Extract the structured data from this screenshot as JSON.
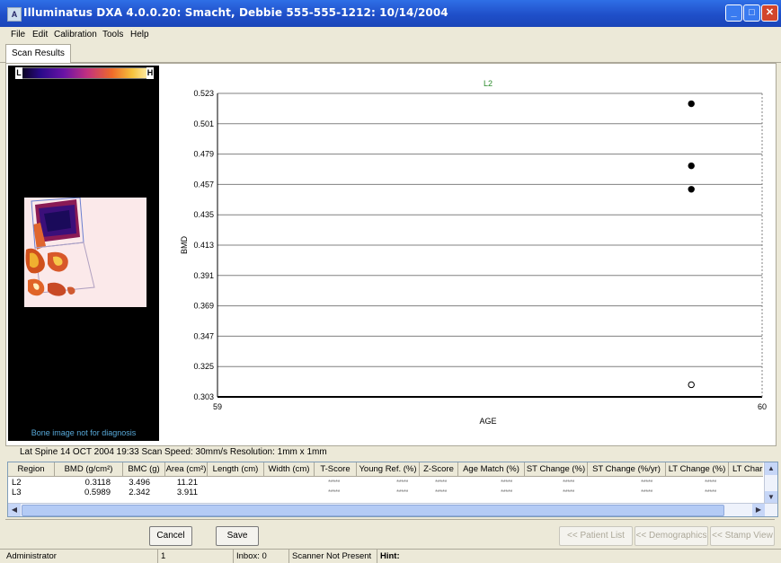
{
  "window": {
    "title": "Illuminatus DXA 4.0.0.20: Smacht, Debbie 555-555-1212: 10/14/2004"
  },
  "menu": [
    "File",
    "Edit",
    "Calibration",
    "Tools",
    "Help"
  ],
  "tabs": [
    "Scan Results"
  ],
  "bone_panel": {
    "scale_low": "L",
    "scale_high": "H",
    "note": "Bone image not for diagnosis"
  },
  "chart_data": {
    "type": "scatter",
    "title": "L2",
    "xlabel": "AGE",
    "ylabel": "BMD",
    "xlim": [
      59,
      60
    ],
    "ylim": [
      0.303,
      0.523
    ],
    "x_ticks": [
      "59",
      "60"
    ],
    "y_ticks": [
      "0.523",
      "0.501",
      "0.479",
      "0.457",
      "0.435",
      "0.413",
      "0.391",
      "0.369",
      "0.347",
      "0.325",
      "0.303"
    ],
    "grid": true,
    "points": [
      {
        "x": 59.87,
        "y": 0.5155,
        "filled": true
      },
      {
        "x": 59.87,
        "y": 0.4705,
        "filled": true
      },
      {
        "x": 59.87,
        "y": 0.4535,
        "filled": true
      },
      {
        "x": 59.87,
        "y": 0.3118,
        "filled": false
      }
    ]
  },
  "scan_info": "Lat Spine   14 OCT 2004   19:33   Scan Speed: 30mm/s   Resolution: 1mm x 1mm",
  "table": {
    "headers": [
      "Region",
      "BMD (g/cm²)",
      "BMC (g)",
      "Area (cm²)",
      "Length (cm)",
      "Width (cm)",
      "T-Score",
      "Young Ref. (%)",
      "Z-Score",
      "Age Match (%)",
      "ST Change (%)",
      "ST Change (%/yr)",
      "LT Change (%)",
      "LT Char"
    ],
    "rows": [
      [
        "L2",
        "0.3118",
        "3.496",
        "11.21",
        "",
        "",
        "*****",
        "*****",
        "*****",
        "*****",
        "*****",
        "*****",
        "*****",
        ""
      ],
      [
        "L3",
        "0.5989",
        "2.342",
        "3.911",
        "",
        "",
        "*****",
        "*****",
        "*****",
        "*****",
        "*****",
        "*****",
        "*****",
        ""
      ]
    ]
  },
  "buttons": {
    "cancel": "Cancel",
    "save": "Save",
    "patient_list": "<< Patient List",
    "demographics": "<< Demographics",
    "stamp_view": "<< Stamp View"
  },
  "status": {
    "user": "Administrator",
    "count": "1",
    "inbox": "Inbox: 0",
    "scanner": "Scanner Not Present",
    "hint": "Hint:"
  }
}
